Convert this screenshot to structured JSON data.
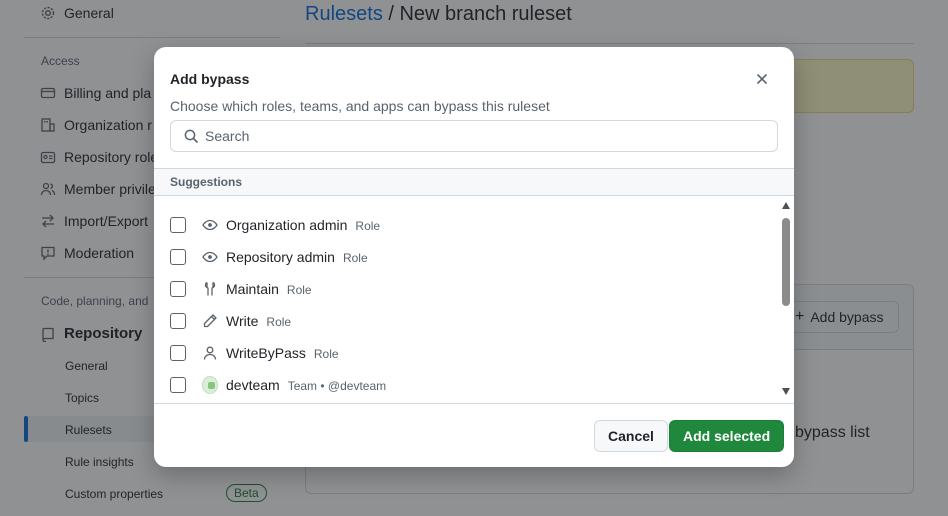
{
  "sidebar": {
    "top_item": {
      "label": "General",
      "icon": "gear-icon"
    },
    "access_heading": "Access",
    "access_items": [
      {
        "label": "Billing and pla",
        "icon": "credit-card-icon"
      },
      {
        "label": "Organization r",
        "icon": "organization-icon"
      },
      {
        "label": "Repository role",
        "icon": "id-badge-icon"
      },
      {
        "label": "Member privile",
        "icon": "people-icon"
      },
      {
        "label": "Import/Export",
        "icon": "arrow-switch-icon"
      },
      {
        "label": "Moderation",
        "icon": "report-icon"
      }
    ],
    "code_heading": "Code, planning, and",
    "repository_label": "Repository",
    "repository_sub": [
      "General",
      "Topics",
      "Rulesets",
      "Rule insights",
      "Custom properties"
    ],
    "beta_badge": "Beta"
  },
  "main": {
    "breadcrumb_link": "Rulesets",
    "breadcrumb_sep": " / ",
    "title": "New branch ruleset",
    "add_bypass_label": "Add bypass",
    "bypass_list_text": "bypass list"
  },
  "dialog": {
    "title": "Add bypass",
    "subtitle": "Choose which roles, teams, and apps can bypass this ruleset",
    "search_placeholder": "Search",
    "suggestions_heading": "Suggestions",
    "items": [
      {
        "name": "Organization admin",
        "meta": "Role",
        "icon": "eye-icon"
      },
      {
        "name": "Repository admin",
        "meta": "Role",
        "icon": "eye-icon"
      },
      {
        "name": "Maintain",
        "meta": "Role",
        "icon": "tools-icon"
      },
      {
        "name": "Write",
        "meta": "Role",
        "icon": "pencil-icon"
      },
      {
        "name": "WriteByPass",
        "meta": "Role",
        "icon": "person-icon"
      },
      {
        "name": "devteam",
        "meta": "Team • @devteam",
        "icon": "team-avatar"
      }
    ],
    "cancel_label": "Cancel",
    "add_selected_label": "Add selected"
  },
  "colors": {
    "accent": "#0969da",
    "primary_button": "#1f883d",
    "overlay": "rgba(31,35,40,0.5)"
  }
}
